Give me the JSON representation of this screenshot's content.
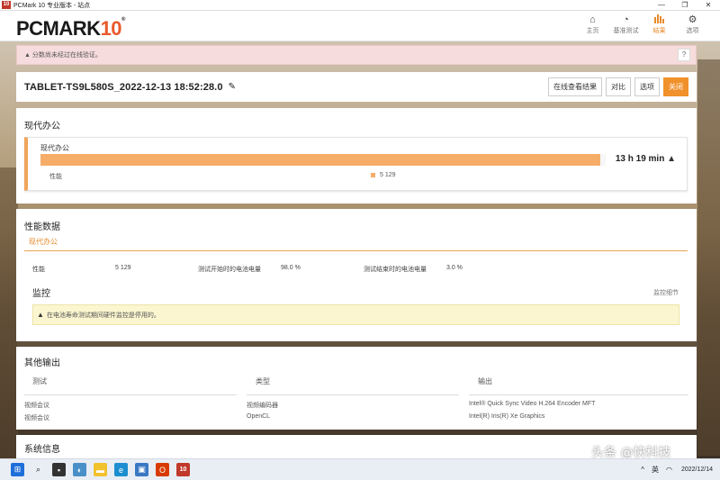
{
  "window": {
    "title": "PCMark 10 专业版本 - 站点",
    "app_badge": "10"
  },
  "header": {
    "logo_main": "PCMARK",
    "logo_num": "10",
    "nav": [
      {
        "label": "主页",
        "icon": "home-icon"
      },
      {
        "label": "基准测试",
        "icon": "gauge-icon"
      },
      {
        "label": "结果",
        "icon": "bar-chart-icon",
        "active": true
      },
      {
        "label": "选项",
        "icon": "gear-icon"
      }
    ]
  },
  "alert_warning": {
    "text": "分数尚未经过在线验证。",
    "help": "?"
  },
  "result": {
    "name": "TABLET-TS9L580S_2022-12-13 18:52:28.0",
    "buttons": {
      "view_online": "在线查看结果",
      "compare": "对比",
      "options": "选项",
      "close": "关闭"
    }
  },
  "modern_office": {
    "title": "现代办公",
    "card_label": "现代办公",
    "duration": "13 h 19 min",
    "progress": 0.99,
    "perf_label": "性能",
    "legend_value": "5 129"
  },
  "perf_data": {
    "title": "性能数据",
    "tab": "现代办公",
    "rows": [
      {
        "label": "性能",
        "value": "5 129"
      },
      {
        "label": "测试开始时的电池电量",
        "value": "98.0 %"
      },
      {
        "label": "测试结束时的电池电量",
        "value": "3.0 %"
      }
    ],
    "monitor_title": "监控",
    "monitor_link": "监控细节",
    "monitor_alert": "在电池寿命测试期间硬件监控是停用的。"
  },
  "other_output": {
    "title": "其他输出",
    "headers": [
      "测试",
      "类型",
      "输出"
    ],
    "rows": [
      [
        "视频会议",
        "视频编码器",
        "Intel® Quick Sync Video H.264 Encoder MFT"
      ],
      [
        "视频会议",
        "OpenCL",
        "Intel(R) Iris(R) Xe Graphics"
      ]
    ]
  },
  "system_info": {
    "title": "系统信息"
  },
  "watermark": "头条 @快科技",
  "taskbar": {
    "ime": "英",
    "date": "2022/12/14"
  }
}
